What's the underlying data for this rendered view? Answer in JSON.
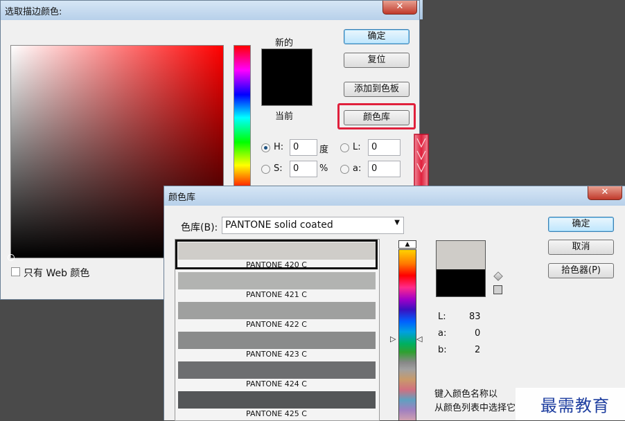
{
  "picker": {
    "title": "选取描边颜色:",
    "close_label": "✕",
    "new_label": "新的",
    "current_label": "当前",
    "ok_label": "确定",
    "reset_label": "复位",
    "add_to_swatches_label": "添加到色板",
    "color_libraries_label": "颜色库",
    "web_only_label": "只有 Web 颜色",
    "new_color": "#000000",
    "current_color": "#000000",
    "fields": {
      "h": {
        "label": "H:",
        "value": "0",
        "unit": "度"
      },
      "s": {
        "label": "S:",
        "value": "0",
        "unit": "%"
      },
      "l": {
        "label": "L:",
        "value": "0"
      },
      "a": {
        "label": "a:",
        "value": "0"
      }
    }
  },
  "libraries": {
    "title": "颜色库",
    "close_label": "✕",
    "book_label": "色库(B):",
    "book_value": "PANTONE solid coated",
    "ok_label": "确定",
    "cancel_label": "取消",
    "picker_label": "拾色器(P)",
    "lab": {
      "l_label": "L:",
      "l_value": "83",
      "a_label": "a:",
      "a_value": "0",
      "b_label": "b:",
      "b_value": "2"
    },
    "hint_line1": "键入颜色名称以",
    "hint_line2": "从颜色列表中选择它",
    "new_color": "#cfccc8",
    "current_color": "#000000",
    "swatches": [
      {
        "name": "PANTONE 420 C",
        "color": "#cfcdc9"
      },
      {
        "name": "PANTONE 421 C",
        "color": "#b2b3b1"
      },
      {
        "name": "PANTONE 422 C",
        "color": "#9fa09f"
      },
      {
        "name": "PANTONE 423 C",
        "color": "#8a8b8b"
      },
      {
        "name": "PANTONE 424 C",
        "color": "#6d6e70"
      },
      {
        "name": "PANTONE 425 C",
        "color": "#545658"
      }
    ]
  },
  "watermark": "最需教育",
  "accent": "#e0203c"
}
